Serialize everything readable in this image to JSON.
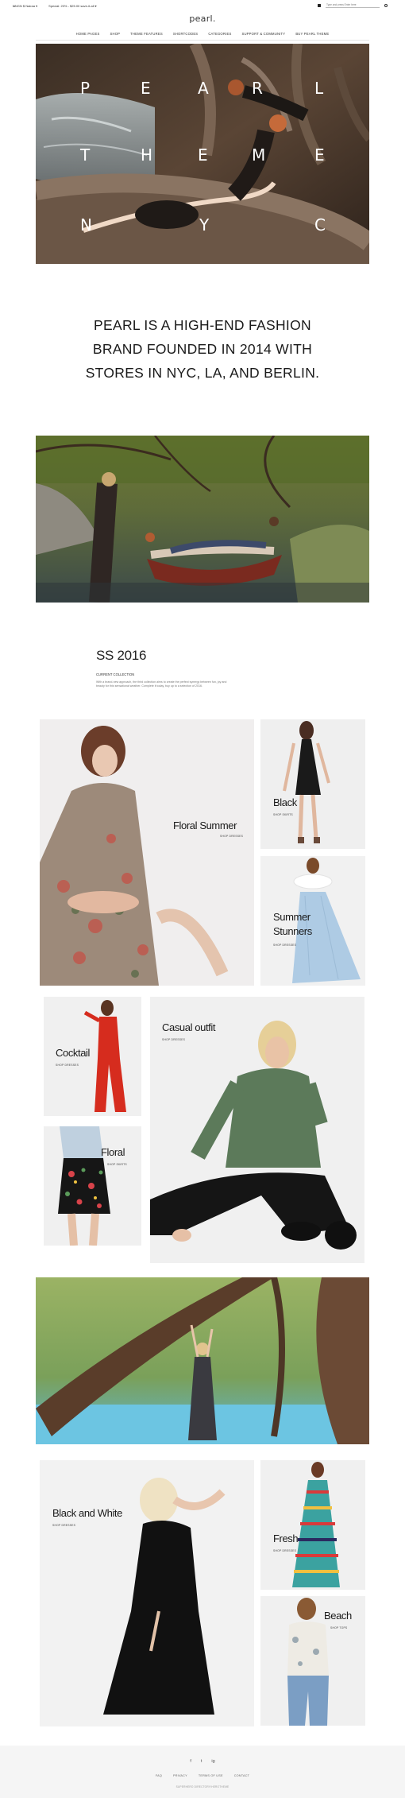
{
  "topbar": {
    "currency": "₦NGN $ Nairaa ▾",
    "promo": "Special: 20% - $25.00 save-it-all ▾",
    "search_placeholder": "Type and press Enter here"
  },
  "header": {
    "logo": "pearl.",
    "nav": [
      "HOME PAGES",
      "SHOP",
      "THEME FEATURES",
      "SHORTCODES",
      "CATEGORIES",
      "SUPPORT & COMMUNITY",
      "BUY PEARL THEME"
    ]
  },
  "hero": {
    "letters": [
      "P",
      "E",
      "A",
      "R",
      "L",
      "T",
      "H",
      "E",
      "M",
      "E",
      "N",
      "Y",
      "C"
    ]
  },
  "intro": {
    "line1": "PEARL IS A HIGH-END FASHION",
    "line2": "BRAND FOUNDED IN 2014 WITH",
    "line3": "STORES IN NYC, LA, AND BERLIN."
  },
  "collection": {
    "title": "SS 2016",
    "subtitle": "CURRENT COLLECTION",
    "description": "With a brand-new approach, the third collection aims to create the perfect synergy between fun, joy and beauty for this sensational weather. Complete it today, buy up to a selection of 2016."
  },
  "cards": {
    "floral_summer": {
      "title": "Floral Summer",
      "sub": "SHOP DRESSES"
    },
    "black": {
      "title": "Black",
      "sub": "SHOP SKIRTS"
    },
    "summer_stunners": {
      "title_line1": "Summer",
      "title_line2": "Stunners",
      "sub": "SHOP DRESSES"
    },
    "cocktail": {
      "title": "Cocktail",
      "sub": "SHOP DRESSES"
    },
    "casual_outfit": {
      "title": "Casual outfit",
      "sub": "SHOP DRESSES"
    },
    "floral": {
      "title": "Floral",
      "sub": "SHOP SKIRTS"
    },
    "black_and_white": {
      "title": "Black and White",
      "sub": "SHOP DRESSES"
    },
    "fresh": {
      "title": "Fresh",
      "sub": "SHOP DRESSES"
    },
    "beach": {
      "title": "Beach",
      "sub": "SHOP TOPS"
    }
  },
  "footer": {
    "social": [
      "f",
      "t",
      "ig"
    ],
    "links": [
      "FAQ",
      "PRIVACY",
      "TERMS OF USE",
      "CONTACT"
    ],
    "copyright": "SUPERHERO DIRECTORY/HEROTHEME"
  },
  "colors": {
    "accent": "#222222",
    "footer_bg": "#f5f5f5",
    "card_bg": "#f1f1f1"
  }
}
